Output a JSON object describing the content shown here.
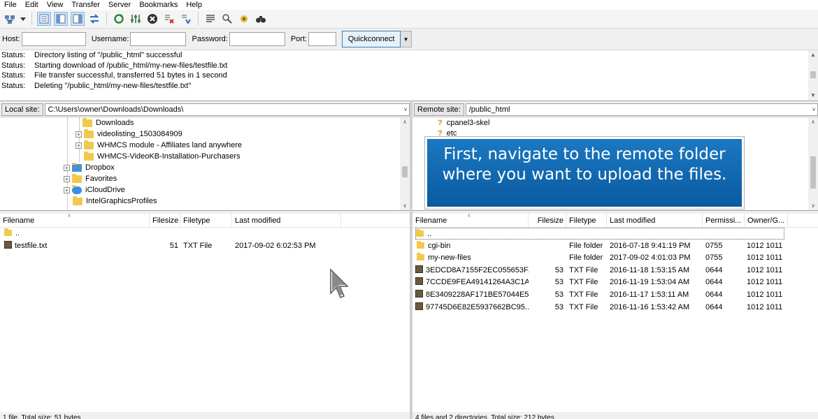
{
  "menu": [
    "File",
    "Edit",
    "View",
    "Transfer",
    "Server",
    "Bookmarks",
    "Help"
  ],
  "toolbar": {
    "icons": [
      "site-manager-icon",
      "dropdown-icon",
      "toggle-log-icon",
      "toggle-local-tree-icon",
      "toggle-remote-tree-icon",
      "toggle-queue-icon",
      "refresh-icon",
      "process-queue-icon",
      "cancel-icon",
      "disconnect-icon",
      "reconnect-icon",
      "directory-filter-icon",
      "compare-icon",
      "sync-browsing-icon",
      "search-icon"
    ]
  },
  "quickconnect": {
    "host_label": "Host:",
    "host_value": "",
    "username_label": "Username:",
    "username_value": "",
    "password_label": "Password:",
    "password_value": "",
    "port_label": "Port:",
    "port_value": "",
    "button_label": "Quickconnect"
  },
  "log": [
    {
      "label": "Status:",
      "message": "Directory listing of \"/public_html\" successful"
    },
    {
      "label": "Status:",
      "message": "Starting download of /public_html/my-new-files/testfile.txt"
    },
    {
      "label": "Status:",
      "message": "File transfer successful, transferred 51 bytes in 1 second"
    },
    {
      "label": "Status:",
      "message": "Deleting \"/public_html/my-new-files/testfile.txt\""
    }
  ],
  "local": {
    "site_label": "Local site:",
    "path": "C:\\Users\\owner\\Downloads\\Downloads\\",
    "tree": [
      {
        "label": "Downloads",
        "expander": false
      },
      {
        "label": "videolisting_1503084909",
        "expander": true
      },
      {
        "label": "WHMCS module - Affiliates land anywhere",
        "expander": true
      },
      {
        "label": "WHMCS-VideoKB-Installation-Purchasers",
        "expander": false
      },
      {
        "label": "Dropbox",
        "expander": true
      },
      {
        "label": "Favorites",
        "expander": true
      },
      {
        "label": "iCloudDrive",
        "expander": true
      },
      {
        "label": "IntelGraphicsProfiles",
        "expander": false
      }
    ],
    "columns": [
      "Filename",
      "Filesize",
      "Filetype",
      "Last modified"
    ],
    "files": [
      {
        "name": "..",
        "size": "",
        "type": "",
        "modified": "",
        "kind": "folder"
      },
      {
        "name": "testfile.txt",
        "size": "51",
        "type": "TXT File",
        "modified": "2017-09-02 6:02:53 PM",
        "kind": "file"
      }
    ],
    "status": "1 file. Total size: 51 bytes"
  },
  "remote": {
    "site_label": "Remote site:",
    "path": "/public_html",
    "tree": [
      {
        "label": "cpanel3-skel"
      },
      {
        "label": "etc"
      }
    ],
    "columns": [
      "Filename",
      "Filesize",
      "Filetype",
      "Last modified",
      "Permissi...",
      "Owner/G..."
    ],
    "files": [
      {
        "name": "..",
        "size": "",
        "type": "",
        "modified": "",
        "perms": "",
        "owner": "",
        "kind": "folder"
      },
      {
        "name": "cgi-bin",
        "size": "",
        "type": "File folder",
        "modified": "2016-07-18 9:41:19 PM",
        "perms": "0755",
        "owner": "1012 1011",
        "kind": "folder"
      },
      {
        "name": "my-new-files",
        "size": "",
        "type": "File folder",
        "modified": "2017-09-02 4:01:03 PM",
        "perms": "0755",
        "owner": "1012 1011",
        "kind": "folder"
      },
      {
        "name": "3EDCD8A7155F2EC055653F...",
        "size": "53",
        "type": "TXT File",
        "modified": "2016-11-18 1:53:15 AM",
        "perms": "0644",
        "owner": "1012 1011",
        "kind": "file"
      },
      {
        "name": "7CCDE9FEA49141264A3C1A...",
        "size": "53",
        "type": "TXT File",
        "modified": "2016-11-19 1:53:04 AM",
        "perms": "0644",
        "owner": "1012 1011",
        "kind": "file"
      },
      {
        "name": "8E3409228AF171BE57044E5...",
        "size": "53",
        "type": "TXT File",
        "modified": "2016-11-17 1:53:11 AM",
        "perms": "0644",
        "owner": "1012 1011",
        "kind": "file"
      },
      {
        "name": "97745D6E82E5937662BC95...",
        "size": "53",
        "type": "TXT File",
        "modified": "2016-11-16 1:53:42 AM",
        "perms": "0644",
        "owner": "1012 1011",
        "kind": "file"
      }
    ],
    "status": "4 files and 2 directories. Total size: 212 bytes"
  },
  "callout": {
    "text": "First, navigate to the remote folder where you want to upload the files."
  },
  "colors": {
    "callout_top": "#1b78c2",
    "callout_bottom": "#0a5aa0",
    "folder": "#f2c94c",
    "quickconnect_border": "#3c7fb1"
  }
}
